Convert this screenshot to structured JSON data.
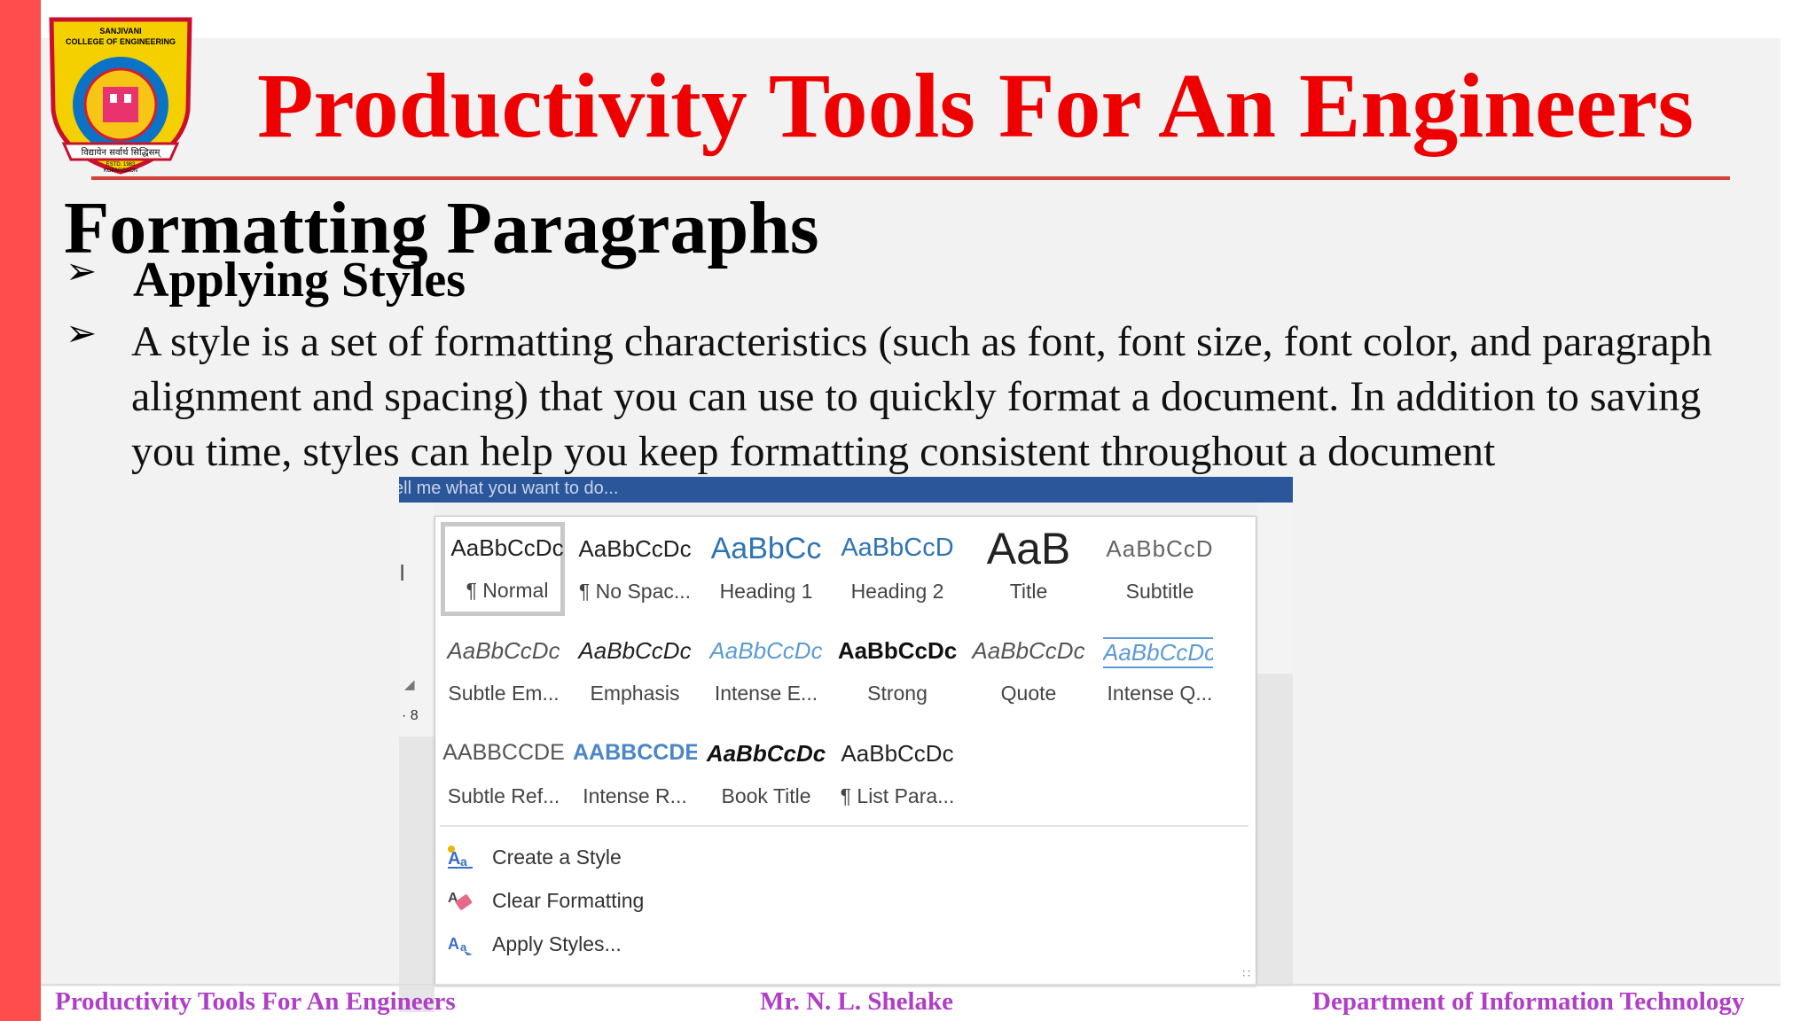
{
  "slide": {
    "title": "Productivity Tools For An Engineers",
    "logo_text": {
      "top": "SANJIVANI",
      "top2": "COLLEGE OF ENGINEERING",
      "banner": "विद्यायेन सर्वार्थ सिद्धिसम्",
      "estd": "ESTD. 1983",
      "place": "KOPARGAON"
    },
    "section_title": "Formatting Paragraphs",
    "bullets": [
      "Applying Styles",
      "A style is a set of formatting characteristics (such as font, font size, font color, and paragraph alignment and spacing) that you can use to quickly format a document. In addition to saving you time, styles can help you keep formatting consistent throughout a document"
    ],
    "footer": {
      "left": "Productivity Tools For An Engineers",
      "center": "Mr. N. L. Shelake",
      "right": "Department of Information Technology"
    },
    "colors": {
      "title": "#ee0000",
      "accent_bar": "#ff4d4d",
      "footer_text": "#b03ec8",
      "word_blue": "#2b579a"
    }
  },
  "word_ui": {
    "tell_me_placeholder": "ell me what you want to do...",
    "left_glyph": "I",
    "ruler_text": "· 8",
    "styles": [
      {
        "sample": "AaBbCcDc",
        "label": "¶ Normal",
        "selected": true
      },
      {
        "sample": "AaBbCcDc",
        "label": "¶ No Spac..."
      },
      {
        "sample": "AaBbCc",
        "label": "Heading 1"
      },
      {
        "sample": "AaBbCcD",
        "label": "Heading 2"
      },
      {
        "sample": "AaB",
        "label": "Title"
      },
      {
        "sample": "AaBbCcD",
        "label": "Subtitle"
      },
      {
        "sample": "AaBbCcDc",
        "label": "Subtle Em..."
      },
      {
        "sample": "AaBbCcDc",
        "label": "Emphasis"
      },
      {
        "sample": "AaBbCcDc",
        "label": "Intense E..."
      },
      {
        "sample": "AaBbCcDc",
        "label": "Strong"
      },
      {
        "sample": "AaBbCcDc",
        "label": "Quote"
      },
      {
        "sample": "AaBbCcDc",
        "label": "Intense Q..."
      },
      {
        "sample": "AABBCCDE",
        "label": "Subtle Ref..."
      },
      {
        "sample": "AABBCCDE",
        "label": "Intense R..."
      },
      {
        "sample": "AaBbCcDc",
        "label": "Book Title"
      },
      {
        "sample": "AaBbCcDc",
        "label": "¶ List Para..."
      }
    ],
    "menu": [
      {
        "label": "Create a Style",
        "icon": "create-style-icon"
      },
      {
        "label": "Clear Formatting",
        "icon": "clear-formatting-icon"
      },
      {
        "label": "Apply Styles...",
        "icon": "apply-styles-icon"
      }
    ]
  }
}
